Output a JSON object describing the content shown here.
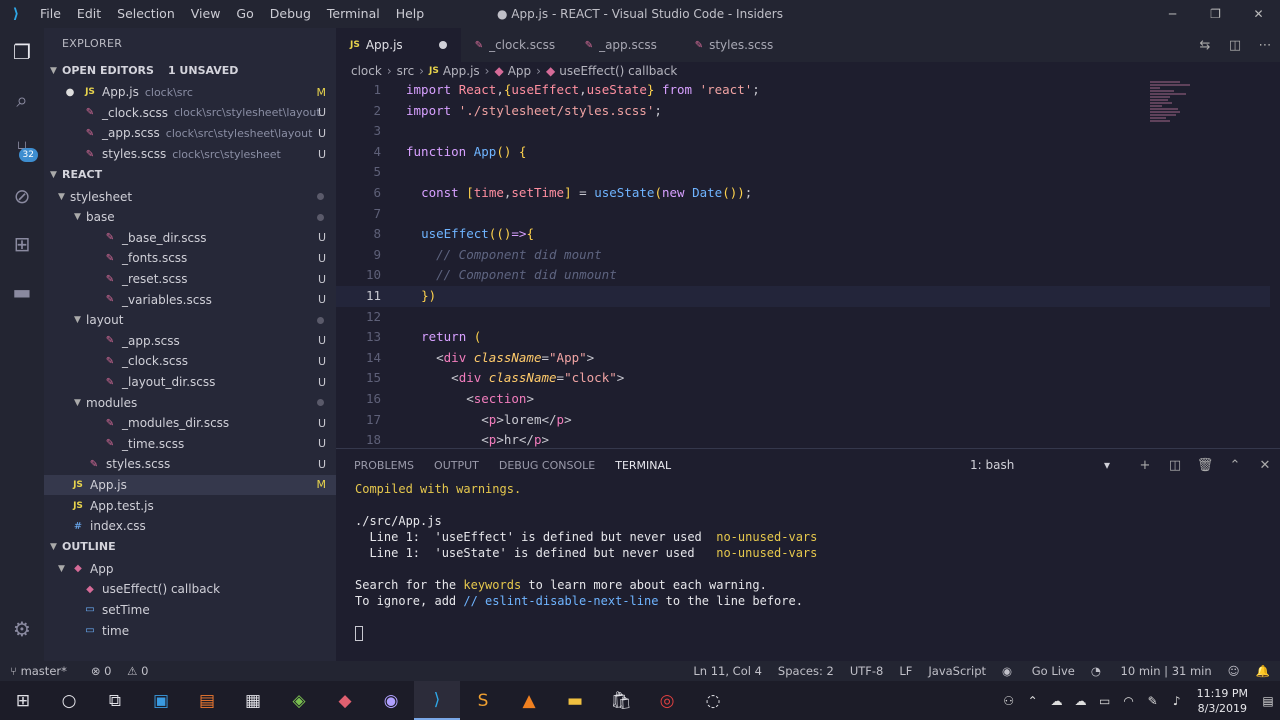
{
  "window": {
    "title": "● App.js - REACT - Visual Studio Code - Insiders",
    "menu": [
      "File",
      "Edit",
      "Selection",
      "View",
      "Go",
      "Debug",
      "Terminal",
      "Help"
    ]
  },
  "sidebar": {
    "title": "EXPLORER",
    "open_editors": {
      "label": "OPEN EDITORS",
      "unsaved": "1 UNSAVED",
      "items": [
        {
          "name": "App.js",
          "path": "clock\\src",
          "status": "M"
        },
        {
          "name": "_clock.scss",
          "path": "clock\\src\\stylesheet\\layout",
          "status": "U"
        },
        {
          "name": "_app.scss",
          "path": "clock\\src\\stylesheet\\layout",
          "status": "U"
        },
        {
          "name": "styles.scss",
          "path": "clock\\src\\stylesheet",
          "status": "U"
        }
      ]
    },
    "project": {
      "label": "REACT",
      "tree": [
        {
          "name": "stylesheet",
          "folder": true,
          "depth": 1
        },
        {
          "name": "base",
          "folder": true,
          "depth": 2
        },
        {
          "name": "_base_dir.scss",
          "depth": 3,
          "status": "U"
        },
        {
          "name": "_fonts.scss",
          "depth": 3,
          "status": "U"
        },
        {
          "name": "_reset.scss",
          "depth": 3,
          "status": "U"
        },
        {
          "name": "_variables.scss",
          "depth": 3,
          "status": "U"
        },
        {
          "name": "layout",
          "folder": true,
          "depth": 2
        },
        {
          "name": "_app.scss",
          "depth": 3,
          "status": "U"
        },
        {
          "name": "_clock.scss",
          "depth": 3,
          "status": "U"
        },
        {
          "name": "_layout_dir.scss",
          "depth": 3,
          "status": "U"
        },
        {
          "name": "modules",
          "folder": true,
          "depth": 2
        },
        {
          "name": "_modules_dir.scss",
          "depth": 3,
          "status": "U"
        },
        {
          "name": "_time.scss",
          "depth": 3,
          "status": "U"
        },
        {
          "name": "styles.scss",
          "depth": 2,
          "status": "U"
        },
        {
          "name": "App.js",
          "depth": 1,
          "status": "M",
          "js": true
        },
        {
          "name": "App.test.js",
          "depth": 1,
          "js": true
        },
        {
          "name": "index.css",
          "depth": 1,
          "css": true
        }
      ]
    },
    "outline": {
      "label": "OUTLINE",
      "items": [
        {
          "name": "App",
          "depth": 1
        },
        {
          "name": "useEffect() callback",
          "depth": 2
        },
        {
          "name": "setTime",
          "depth": 2
        },
        {
          "name": "time",
          "depth": 2
        }
      ]
    }
  },
  "tabs": [
    {
      "label": "App.js",
      "active": true,
      "unsaved": true
    },
    {
      "label": "_clock.scss"
    },
    {
      "label": "_app.scss"
    },
    {
      "label": "styles.scss"
    }
  ],
  "breadcrumb": [
    "clock",
    "src",
    "App.js",
    "App",
    "useEffect() callback"
  ],
  "panel": {
    "tabs": [
      "PROBLEMS",
      "OUTPUT",
      "DEBUG CONSOLE",
      "TERMINAL"
    ],
    "active_tab": "TERMINAL",
    "terminal_select": "1: bash",
    "lines": {
      "l1": "Compiled with warnings.",
      "l2": "./src/App.js",
      "l3a": "  Line 1:  'useEffect' is defined but never used  ",
      "l3b": "no-unused-vars",
      "l4a": "  Line 1:  'useState' is defined but never used   ",
      "l4b": "no-unused-vars",
      "l5a": "Search for the ",
      "l5b": "keywords",
      "l5c": " to learn more about each warning.",
      "l6a": "To ignore, add ",
      "l6b": "// eslint-disable-next-line",
      "l6c": " to the line before."
    }
  },
  "status": {
    "branch": "master*",
    "errors": "0",
    "warnings": "0",
    "position": "Ln 11, Col 4",
    "spaces": "Spaces: 2",
    "encoding": "UTF-8",
    "eol": "LF",
    "language": "JavaScript",
    "live": "Go Live",
    "time_tracked": "10 min | 31 min"
  },
  "taskbar": {
    "time": "11:19 PM",
    "date": "8/3/2019"
  },
  "colors": {
    "accent": "#2fa8e8",
    "keyword": "#d7a0ff",
    "function": "#6fb4ff",
    "string": "#f0a3a3",
    "warning": "#e6c84d"
  }
}
